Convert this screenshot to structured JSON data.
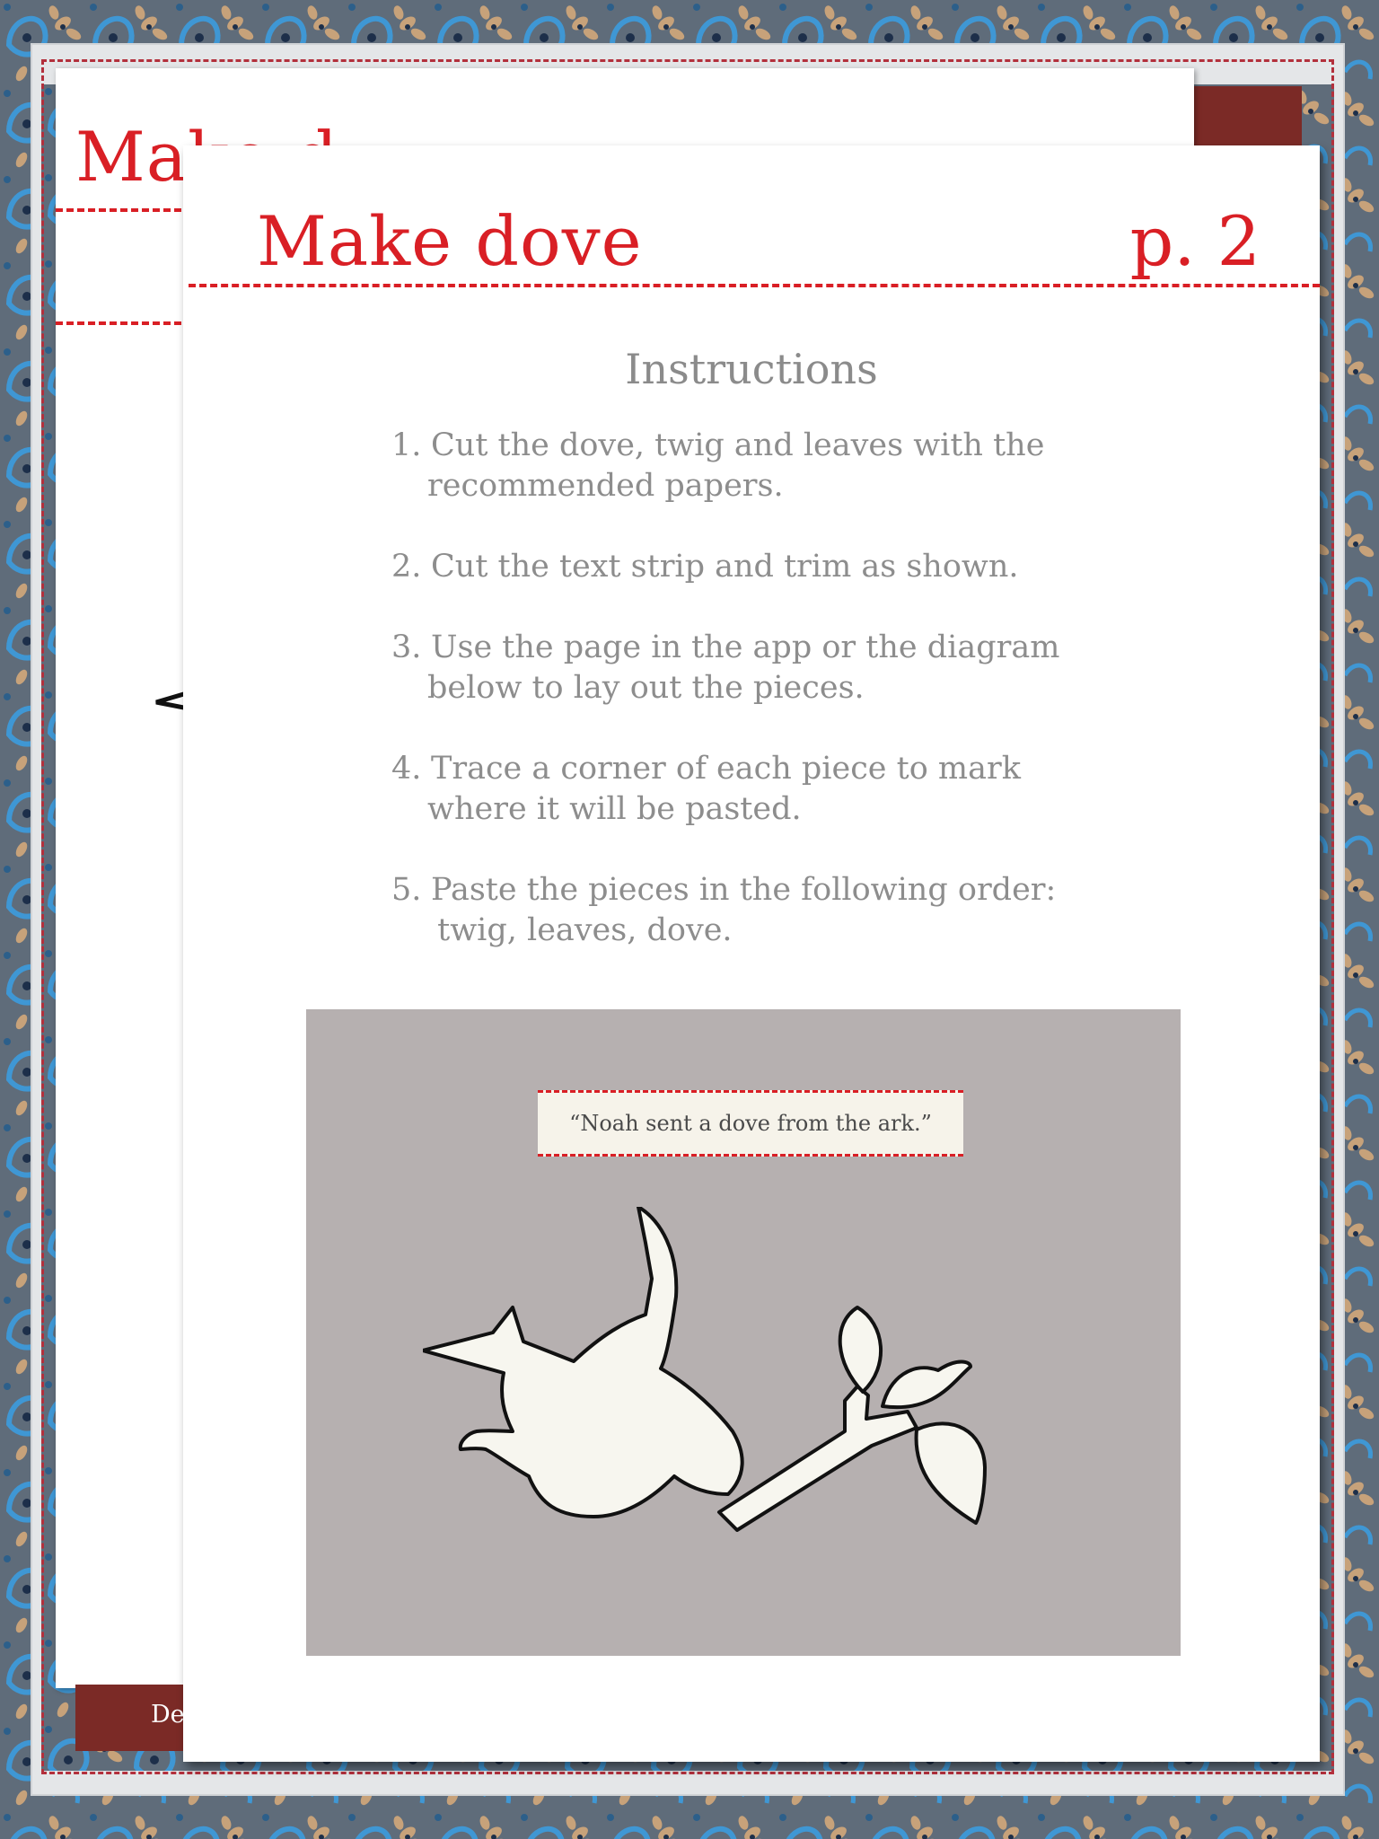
{
  "background": {
    "pattern": "paisley-blue-tan",
    "stitch_color": "#b3303c"
  },
  "back_page": {
    "title": "Make d",
    "footer_label": "De",
    "accent_color": "#7b2a26"
  },
  "front_page": {
    "title": "Make dove",
    "page_number": "p. 2",
    "title_color": "#d91f25",
    "instructions_heading": "Instructions",
    "steps": [
      {
        "num": "1.",
        "line1": "Cut the dove, twig and leaves with the",
        "line2": "recommended papers."
      },
      {
        "num": "2.",
        "line1": "Cut the text strip and trim as shown.",
        "line2": ""
      },
      {
        "num": "3.",
        "line1": "Use the page in the app or the diagram",
        "line2": "below to lay out the pieces."
      },
      {
        "num": "4.",
        "line1": "Trace a corner of each piece to mark",
        "line2": "where it will be pasted."
      },
      {
        "num": "5.",
        "line1": "Paste the pieces in the following order:",
        "line2": " twig, leaves, dove."
      }
    ],
    "diagram": {
      "quote": "“Noah sent a dove from the ark.”",
      "background_color": "#b6b0b0",
      "illustration": "dove-with-olive-twig-icon"
    }
  }
}
